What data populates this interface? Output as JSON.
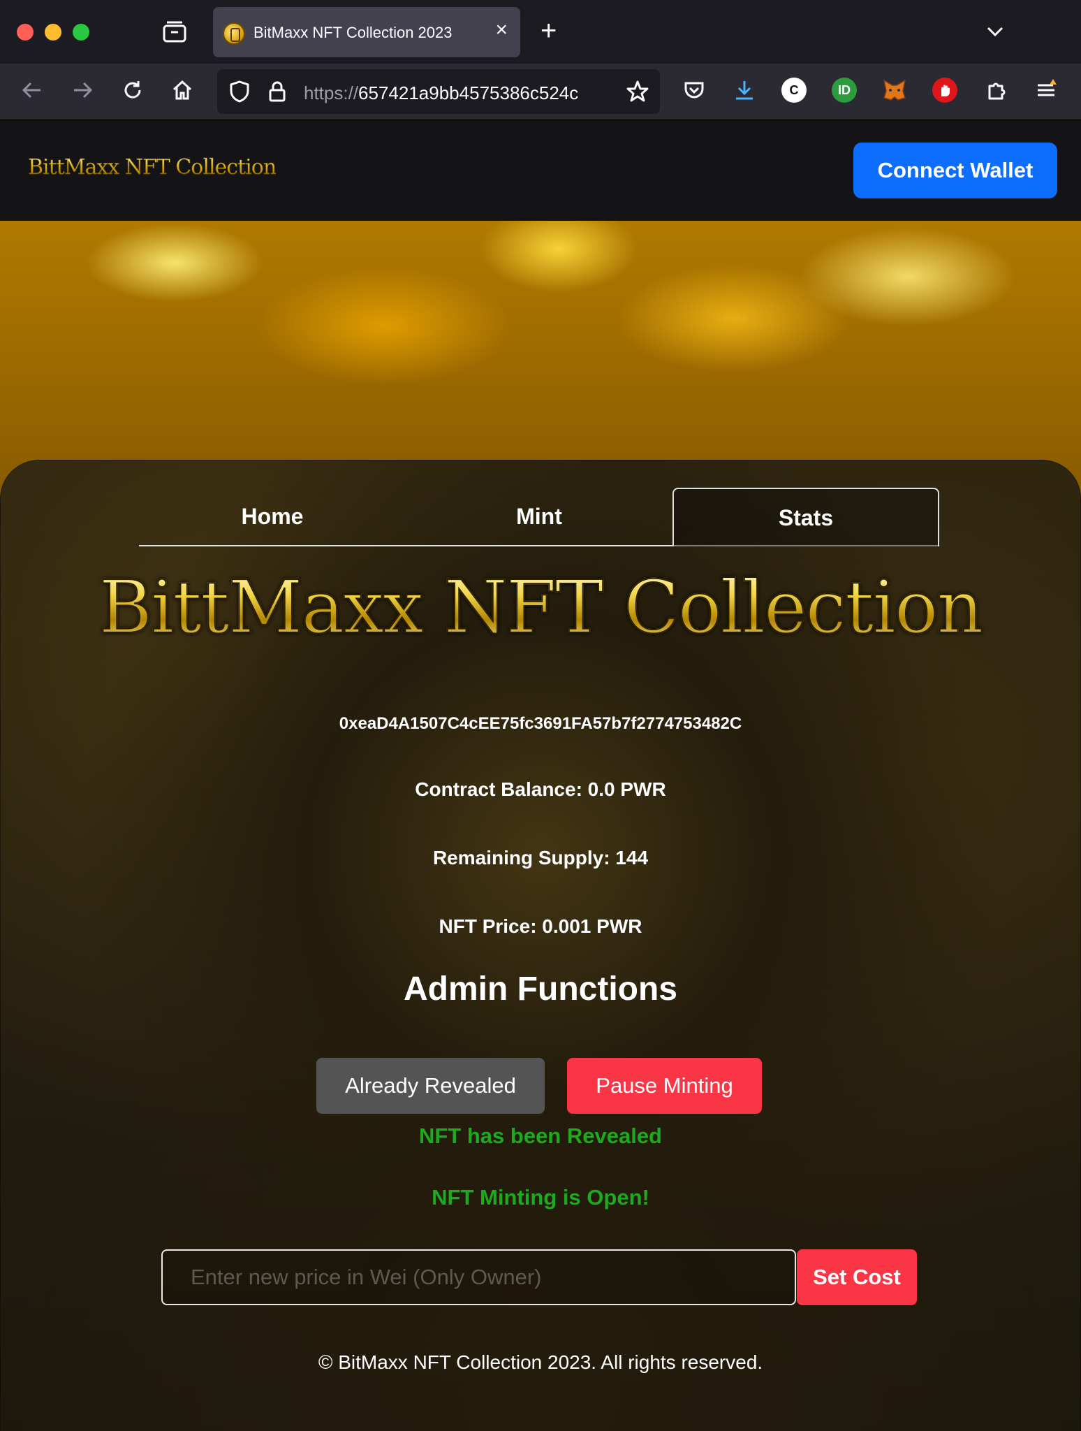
{
  "browser": {
    "tab_title": "BitMaxx NFT Collection 2023",
    "url_scheme": "https://",
    "url_host": "657421a9bb4575386c524c",
    "new_tab_label": "+",
    "tab_close_label": "×"
  },
  "icons": {
    "back": "arrow-left-icon",
    "forward": "arrow-right-icon",
    "reload": "reload-icon",
    "home": "home-icon",
    "shield": "shield-icon",
    "lock": "lock-icon",
    "bookmark": "star-icon",
    "pocket": "pocket-icon",
    "downloads": "download-icon",
    "extensions": "puzzle-icon",
    "menu": "hamburger-menu-icon"
  },
  "header": {
    "logo_text": "BittMaxx NFT Collection",
    "connect_wallet_label": "Connect Wallet"
  },
  "nav_tabs": [
    {
      "label": "Home",
      "active": false
    },
    {
      "label": "Mint",
      "active": false
    },
    {
      "label": "Stats",
      "active": true
    }
  ],
  "main": {
    "logo_text": "BittMaxx NFT Collection",
    "contract_address": "0xeaD4A1507C4cEE75fc3691FA57b7f2774753482C",
    "contract_balance": "Contract Balance: 0.0 PWR",
    "remaining_supply": "Remaining Supply: 144",
    "nft_price": "NFT Price: 0.001 PWR",
    "admin_title": "Admin Functions",
    "reveal_button_label": "Already Revealed",
    "pause_button_label": "Pause Minting",
    "reveal_status": "NFT has been Revealed",
    "minting_status": "NFT Minting is Open!",
    "cost_input_placeholder": "Enter new price in Wei (Only Owner)",
    "cost_input_value": "",
    "set_cost_label": "Set Cost"
  },
  "footer": {
    "text": "© BitMaxx NFT Collection 2023. All rights reserved."
  },
  "colors": {
    "primary_blue": "#0d6efd",
    "danger_red": "#fa3546",
    "disabled_gray": "#545454",
    "success_green": "#1ea91e",
    "gold": "#d4a300"
  }
}
